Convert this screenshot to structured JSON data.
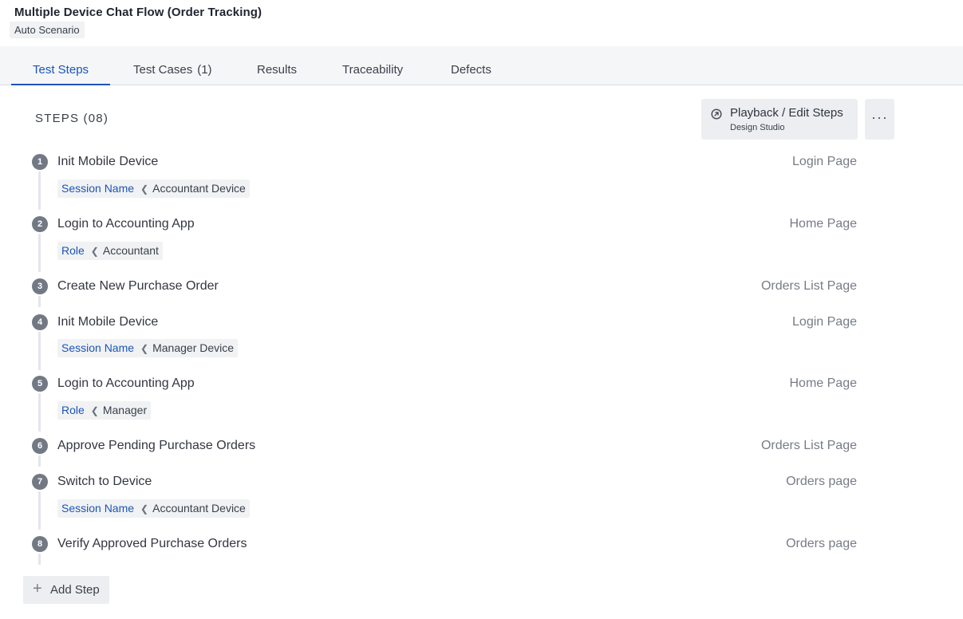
{
  "header": {
    "title": "Multiple Device Chat Flow (Order Tracking)",
    "badge": "Auto Scenario"
  },
  "tabs": [
    {
      "label": "Test Steps",
      "count": "",
      "active": true
    },
    {
      "label": "Test Cases",
      "count": "(1)",
      "active": false
    },
    {
      "label": "Results",
      "count": "",
      "active": false
    },
    {
      "label": "Traceability",
      "count": "",
      "active": false
    },
    {
      "label": "Defects",
      "count": "",
      "active": false
    }
  ],
  "steps_header": {
    "title": "STEPS (08)",
    "playback_label": "Playback / Edit Steps",
    "playback_sub": "Design Studio",
    "more_label": "···"
  },
  "steps": [
    {
      "num": "1",
      "name": "Init Mobile Device",
      "page": "Login Page",
      "param": {
        "key": "Session Name",
        "value": "Accountant Device"
      }
    },
    {
      "num": "2",
      "name": "Login to Accounting App",
      "page": "Home Page",
      "param": {
        "key": "Role",
        "value": "Accountant"
      }
    },
    {
      "num": "3",
      "name": "Create New Purchase Order",
      "page": "Orders List Page",
      "param": null
    },
    {
      "num": "4",
      "name": "Init Mobile Device",
      "page": "Login Page",
      "param": {
        "key": "Session Name",
        "value": "Manager Device"
      }
    },
    {
      "num": "5",
      "name": "Login to Accounting App",
      "page": "Home Page",
      "param": {
        "key": "Role",
        "value": "Manager"
      }
    },
    {
      "num": "6",
      "name": "Approve Pending Purchase Orders",
      "page": "Orders List Page",
      "param": null
    },
    {
      "num": "7",
      "name": "Switch to Device",
      "page": "Orders page",
      "param": {
        "key": "Session Name",
        "value": "Accountant Device"
      }
    },
    {
      "num": "8",
      "name": "Verify Approved Purchase Orders",
      "page": "Orders page",
      "param": null
    }
  ],
  "add_step_label": "Add Step",
  "colors": {
    "accent": "#1a55b8",
    "step_badge": "#737984",
    "tab_bar_bg": "#f5f6f8"
  }
}
